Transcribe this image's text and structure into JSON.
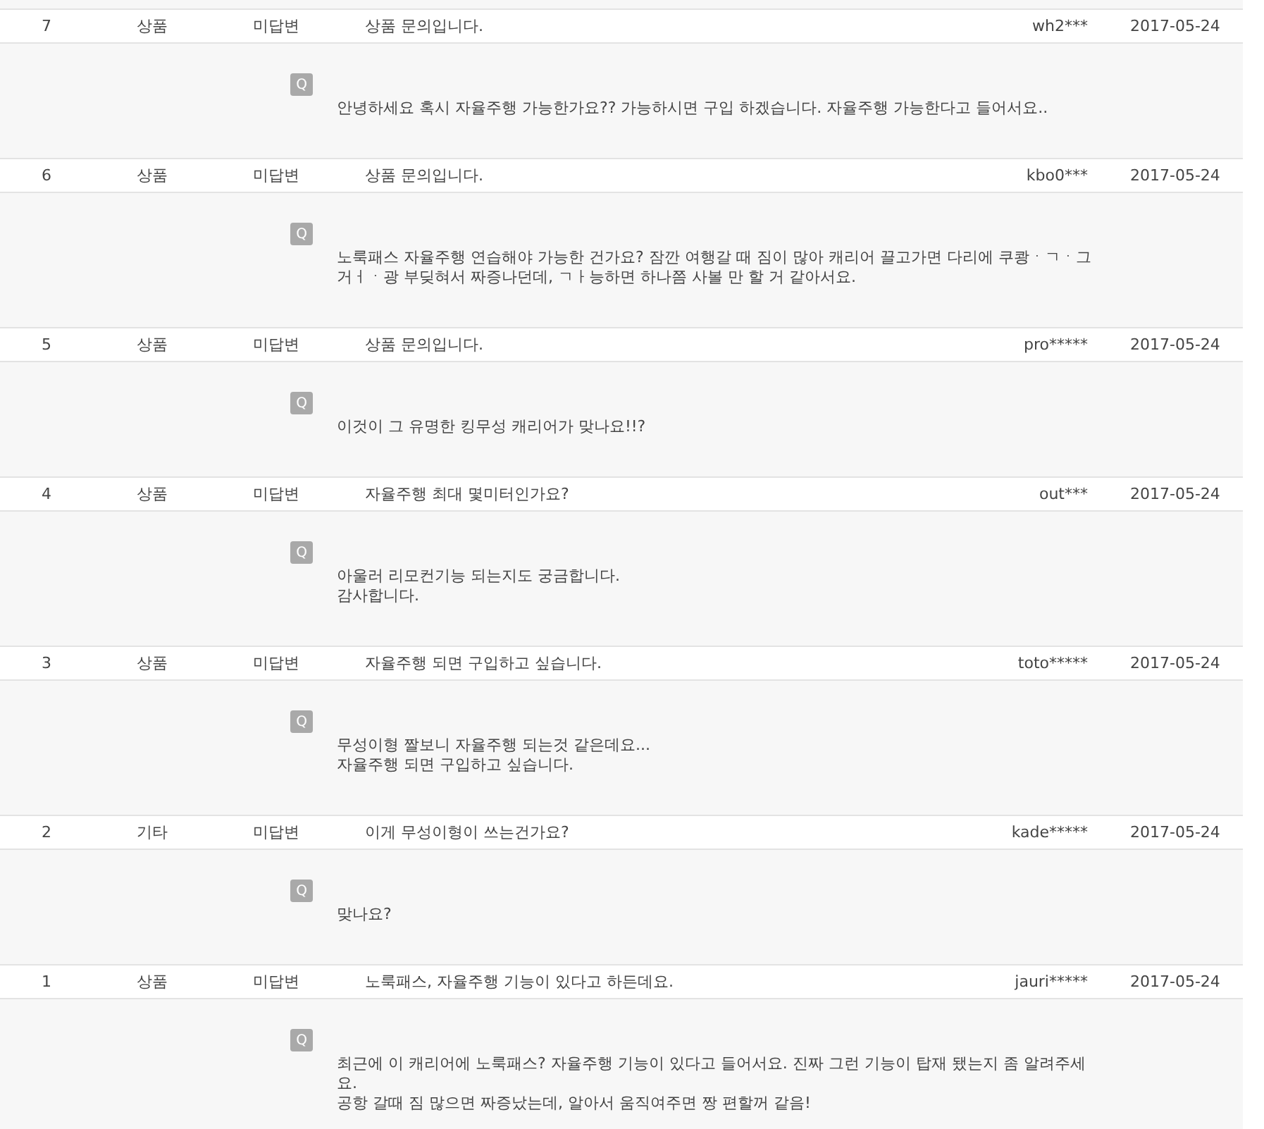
{
  "qna_rows": [
    {
      "number": "7",
      "category": "상품",
      "status": "미답변",
      "title": "상품 문의입니다.",
      "writer": "wh2***",
      "date": "2017-05-24",
      "badge": "Q",
      "lines": [
        "안녕하세요 혹시 자율주행 가능한가요?? 가능하시면 구입 하겠습니다. 자율주행 가능한다고 들어서요.."
      ]
    },
    {
      "number": "6",
      "category": "상품",
      "status": "미답변",
      "title": "상품 문의입니다.",
      "writer": "kbo0***",
      "date": "2017-05-24",
      "badge": "Q",
      "lines": [
        "노룩패스 자율주행 연습해야 가능한 건가요? 잠깐 여행갈 때 짐이 많아 캐리어 끌고가면 다리에 쿠쾅ㆍㄱㆍ그거ㅓㆍ광 부딪혀서 짜증나던데, ㄱㅏ능하면 하나쯤 사볼 만 할 거 같아서요."
      ]
    },
    {
      "number": "5",
      "category": "상품",
      "status": "미답변",
      "title": "상품 문의입니다.",
      "writer": "pro*****",
      "date": "2017-05-24",
      "badge": "Q",
      "lines": [
        "이것이 그 유명한 킹무성 캐리어가 맞나요!!?"
      ]
    },
    {
      "number": "4",
      "category": "상품",
      "status": "미답변",
      "title": "자율주행 최대 몇미터인가요?",
      "writer": "out***",
      "date": "2017-05-24",
      "badge": "Q",
      "lines": [
        "아울러 리모컨기능 되는지도 궁금합니다.",
        "감사합니다."
      ]
    },
    {
      "number": "3",
      "category": "상품",
      "status": "미답변",
      "title": "자율주행 되면 구입하고 싶습니다.",
      "writer": "toto*****",
      "date": "2017-05-24",
      "badge": "Q",
      "lines": [
        "무성이형 짤보니 자율주행 되는것 같은데요...",
        "자율주행 되면 구입하고 싶습니다."
      ]
    },
    {
      "number": "2",
      "category": "기타",
      "status": "미답변",
      "title": "이게 무성이형이 쓰는건가요?",
      "writer": "kade*****",
      "date": "2017-05-24",
      "badge": "Q",
      "lines": [
        "맞나요?"
      ]
    },
    {
      "number": "1",
      "category": "상품",
      "status": "미답변",
      "title": "노룩패스, 자율주행 기능이 있다고 하든데요.",
      "writer": "jauri*****",
      "date": "2017-05-24",
      "badge": "Q",
      "lines": [
        "최근에 이 캐리어에 노룩패스? 자율주행 기능이 있다고 들어서요. 진짜 그런 기능이 탑재 됐는지 좀 알려주세요.",
        "공항 갈때 짐 많으면 짜증났는데, 알아서 움직여주면 짱 편할꺼 같음!"
      ]
    }
  ]
}
